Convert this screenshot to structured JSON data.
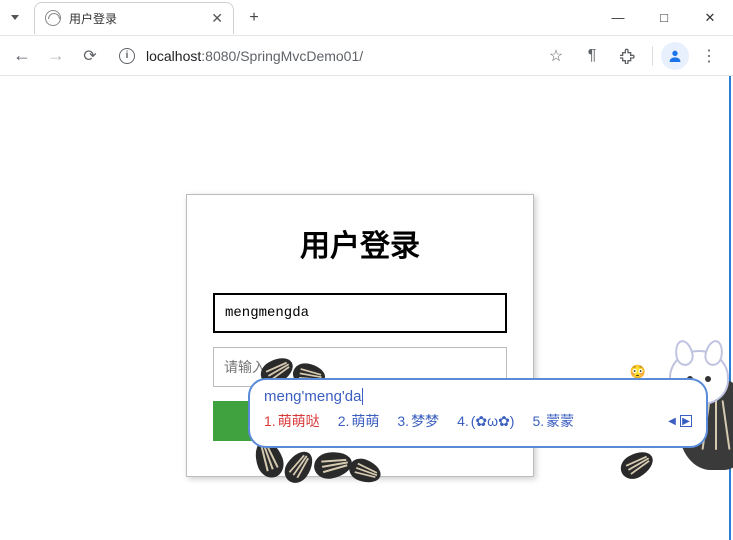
{
  "tab": {
    "title": "用户登录"
  },
  "url": {
    "host": "localhost",
    "port": ":8080",
    "path": "/SpringMvcDemo01/"
  },
  "login": {
    "title": "用户登录",
    "username_value": "mengmengda",
    "password_placeholder": "请输入",
    "submit_label": ""
  },
  "ime": {
    "composition": "meng'meng'da",
    "candidates": [
      {
        "n": "1.",
        "text": "萌萌哒"
      },
      {
        "n": "2.",
        "text": "萌萌"
      },
      {
        "n": "3.",
        "text": "梦梦"
      },
      {
        "n": "4.",
        "text": "(✿ω✿)"
      },
      {
        "n": "5.",
        "text": "蒙蒙"
      }
    ],
    "emoji_hint": "😳"
  }
}
